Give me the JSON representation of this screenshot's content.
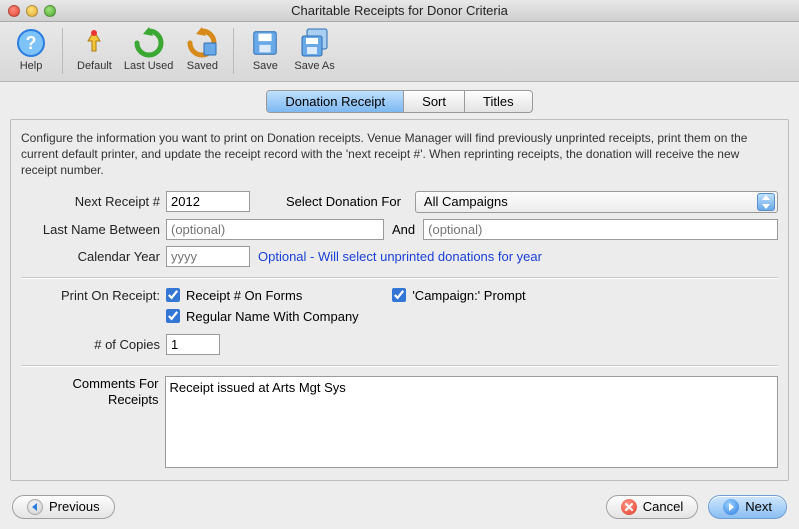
{
  "window": {
    "title": "Charitable Receipts for Donor Criteria"
  },
  "toolbar": {
    "help": "Help",
    "default": "Default",
    "lastUsed": "Last Used",
    "saved": "Saved",
    "save": "Save",
    "saveAs": "Save As"
  },
  "tabs": {
    "donationReceipt": "Donation Receipt",
    "sort": "Sort",
    "titles": "Titles"
  },
  "intro": "Configure the information you want to print on Donation receipts.  Venue Manager will find previously unprinted receipts, print them on the current default printer, and update the receipt record with the 'next receipt #'.  When reprinting receipts, the donation will receive the new receipt number.",
  "form": {
    "nextReceiptLabel": "Next Receipt #",
    "nextReceiptValue": "2012",
    "selectDonationForLabel": "Select Donation For",
    "selectDonationForValue": "All Campaigns",
    "lastNameBetweenLabel": "Last Name Between",
    "lastNameFromPlaceholder": "(optional)",
    "andLabel": "And",
    "lastNameToPlaceholder": "(optional)",
    "calendarYearLabel": "Calendar Year",
    "calendarYearPlaceholder": "yyyy",
    "calendarYearHint": "Optional - Will select unprinted donations for year",
    "printOnReceiptLabel": "Print On Receipt:",
    "chkReceiptOnForms": "Receipt # On Forms",
    "chkCampaignPrompt": "'Campaign:' Prompt",
    "chkRegularName": "Regular Name With Company",
    "copiesLabel": "# of Copies",
    "copiesValue": "1",
    "commentsLabel": "Comments For Receipts",
    "commentsValue": "Receipt issued at Arts Mgt Sys"
  },
  "footer": {
    "previous": "Previous",
    "cancel": "Cancel",
    "next": "Next"
  }
}
